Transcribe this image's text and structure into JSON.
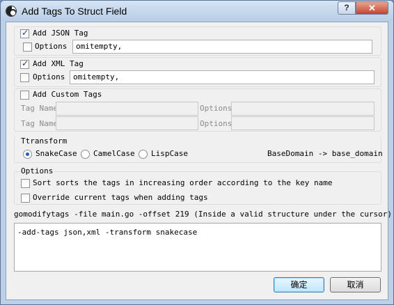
{
  "window": {
    "title": "Add Tags To Struct Field",
    "help_label": "?",
    "close_label": "✕"
  },
  "json_tag": {
    "label": "Add JSON Tag",
    "checked": true,
    "options_label": "Options",
    "options_value": "omitempty,"
  },
  "xml_tag": {
    "label": "Add XML Tag",
    "checked": true,
    "options_label": "Options",
    "options_value": "omitempty,"
  },
  "custom_tags": {
    "label": "Add Custom Tags",
    "checked": false,
    "rows": [
      {
        "tag_name_label": "Tag Name",
        "options_label": "Options",
        "tag_name_value": "",
        "options_value": ""
      },
      {
        "tag_name_label": "Tag Name",
        "options_label": "Options",
        "tag_name_value": "",
        "options_value": ""
      }
    ]
  },
  "transform": {
    "title": "Ttransform",
    "options": [
      "SnakeCase",
      "CamelCase",
      "LispCase"
    ],
    "selected": "SnakeCase",
    "example": "BaseDomain -> base_domain"
  },
  "options_group": {
    "title": "Options",
    "sort_label": "Sort sorts the tags in increasing order according to the key name",
    "override_label": "Override current tags when adding tags"
  },
  "command": {
    "info": "gomodifytags -file main.go -offset 219 (Inside a valid structure under the cursor)",
    "args": "-add-tags json,xml -transform snakecase"
  },
  "buttons": {
    "ok": "确定",
    "cancel": "取消"
  },
  "colors": {
    "client_bg": "#f0f0f0",
    "title_gradient_top": "#d6e4f3",
    "default_button": "#bee6fd",
    "close_button": "#c4442f"
  }
}
